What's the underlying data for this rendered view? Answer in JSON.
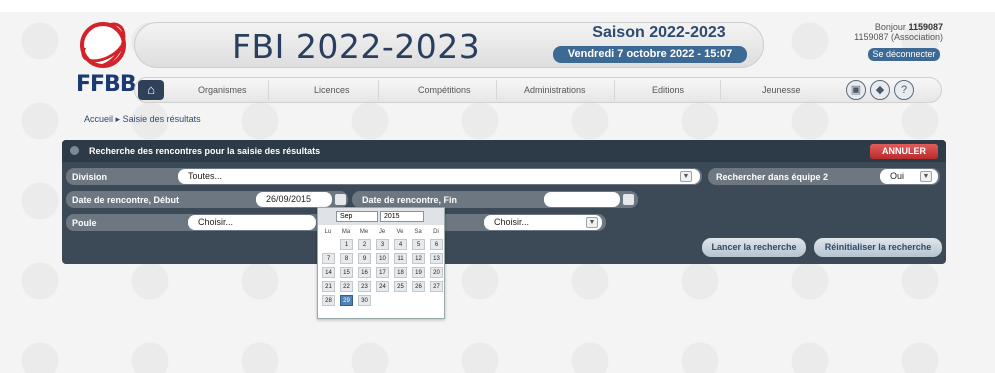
{
  "brand": {
    "name": "FFBB",
    "logo_icon": "ffbb-basketball-logo",
    "accent": "#d2232a",
    "navy": "#1b3a73"
  },
  "header": {
    "title": "FBI 2022-2023",
    "season": "Saison 2022-2023",
    "date": "Vendredi 7 octobre 2022 - 15:07",
    "greeting_prefix": "Bonjour",
    "user_id": "1159087",
    "user_org": "1159087 (Association)",
    "logout_label": "Se déconnecter"
  },
  "nav": {
    "home_icon": "home-icon",
    "items": [
      {
        "label": "Organismes"
      },
      {
        "label": "Licences"
      },
      {
        "label": "Compétitions"
      },
      {
        "label": "Administrations"
      },
      {
        "label": "Editions"
      },
      {
        "label": "Jeunesse"
      }
    ],
    "tools": [
      {
        "icon": "monitor-icon",
        "glyph": "▣"
      },
      {
        "icon": "tag-icon",
        "glyph": "◆"
      },
      {
        "icon": "help-icon",
        "glyph": "?"
      }
    ]
  },
  "breadcrumb": {
    "home": "Accueil",
    "separator": "▸",
    "current": "Saisie des résultats"
  },
  "search": {
    "title": "Recherche des rencontres pour la saisie des résultats",
    "cancel_label": "ANNULER",
    "division": {
      "label": "Division",
      "value": "Toutes..."
    },
    "team_search": {
      "label": "Rechercher dans équipe 2",
      "value": "Oui"
    },
    "date_start": {
      "label": "Date de rencontre, Début",
      "value": "26/09/2015"
    },
    "date_end": {
      "label": "Date de rencontre, Fin",
      "value": ""
    },
    "pool": {
      "label": "Poule",
      "value": "Choisir...",
      "second_value": "Choisir..."
    },
    "launch_label": "Lancer la recherche",
    "reset_label": "Réinitialiser la recherche"
  },
  "datepicker": {
    "month": "Sep",
    "year": "2015",
    "weekdays": [
      "Lu",
      "Ma",
      "Me",
      "Je",
      "Ve",
      "Sa",
      "Di"
    ],
    "days": [
      "1",
      "2",
      "3",
      "4",
      "5",
      "6",
      "7",
      "8",
      "9",
      "10",
      "11",
      "12",
      "13",
      "14",
      "15",
      "16",
      "17",
      "18",
      "19",
      "20",
      "21",
      "22",
      "23",
      "24",
      "25",
      "26",
      "27",
      "28",
      "29",
      "30"
    ],
    "selected_day": "29",
    "first_weekday_index": 1
  },
  "colors": {
    "panel": "#3c4a58",
    "field": "#6c7781",
    "button_blue": "#3d6a94",
    "cancel_red": "#c23636"
  }
}
